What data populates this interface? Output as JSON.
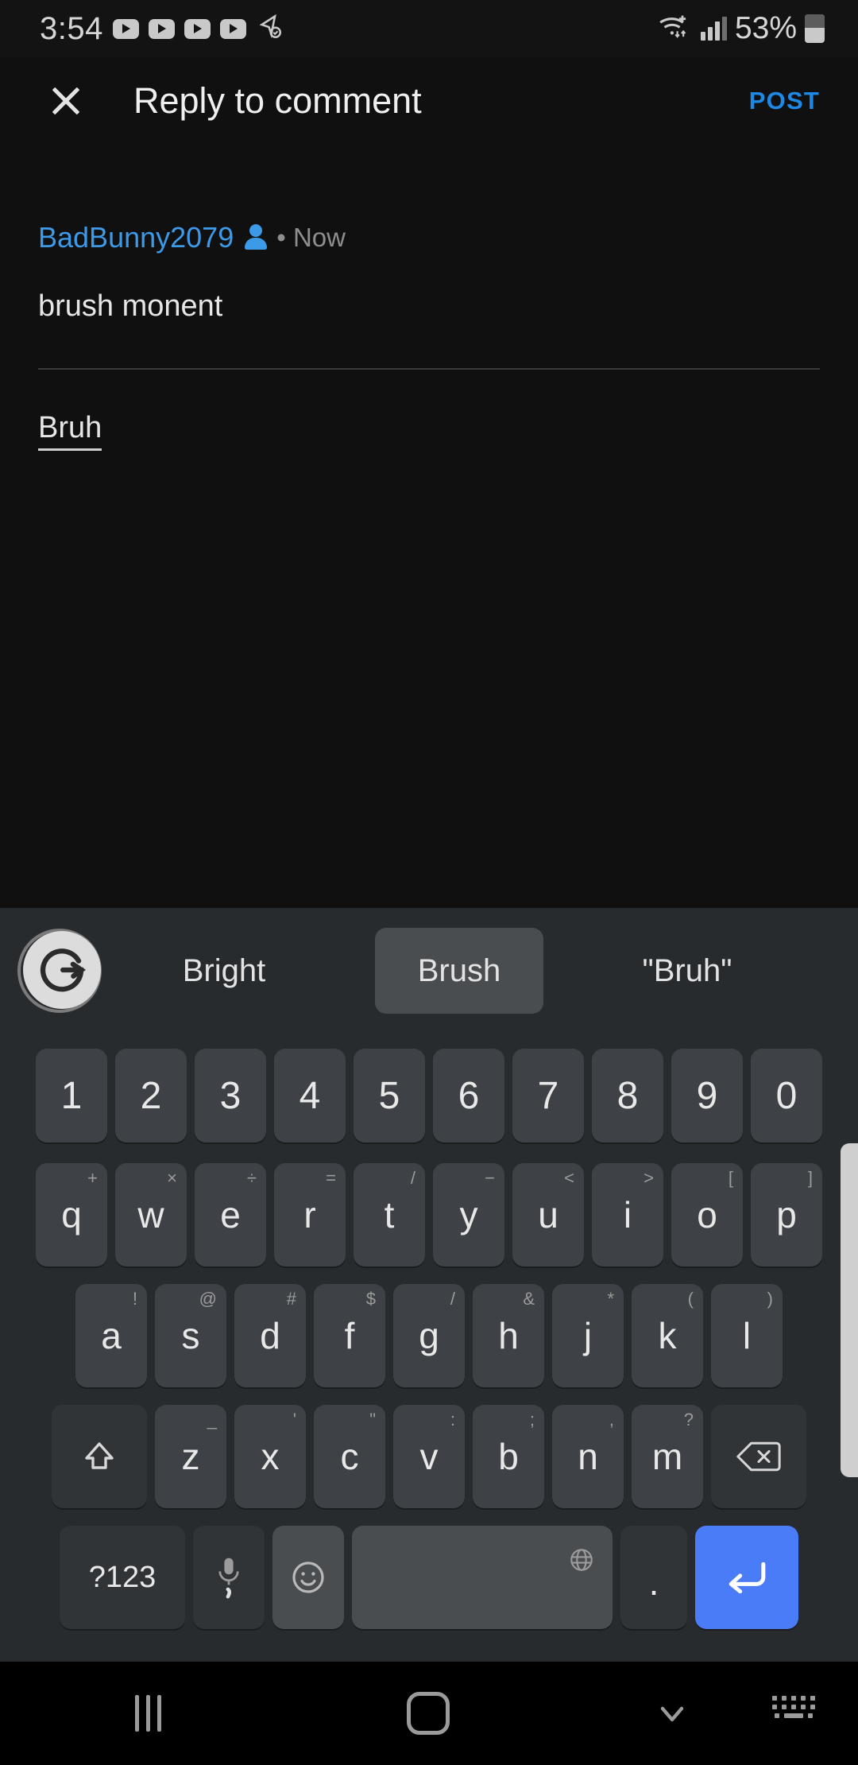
{
  "status_bar": {
    "time": "3:54",
    "notification_icons": [
      "youtube-icon",
      "youtube-icon",
      "youtube-icon",
      "youtube-icon",
      "location-check-icon"
    ],
    "wifi_icon": "wifi-plus-icon",
    "signal_icon": "cellular-signal-icon",
    "battery_percent": "53%",
    "battery_icon": "battery-icon"
  },
  "header": {
    "close_icon": "close-icon",
    "title": "Reply to comment",
    "post_label": "POST",
    "post_color": "#1e88e5"
  },
  "comment": {
    "username": "BadBunny2079",
    "username_color": "#3d9ae8",
    "verified_icon": "person-icon",
    "separator": "•",
    "timestamp": "Now",
    "text": "brush monent"
  },
  "reply_input": {
    "value": "Bruh",
    "composing": true
  },
  "keyboard": {
    "assistant_icon": "grammarly-g-icon",
    "suggestions": [
      {
        "label": "Bright",
        "selected": false
      },
      {
        "label": "Brush",
        "selected": true
      },
      {
        "label": "\"Bruh\"",
        "selected": false
      }
    ],
    "rows": {
      "numbers": [
        {
          "main": "1"
        },
        {
          "main": "2"
        },
        {
          "main": "3"
        },
        {
          "main": "4"
        },
        {
          "main": "5"
        },
        {
          "main": "6"
        },
        {
          "main": "7"
        },
        {
          "main": "8"
        },
        {
          "main": "9"
        },
        {
          "main": "0"
        }
      ],
      "top": [
        {
          "main": "q",
          "sup": "+"
        },
        {
          "main": "w",
          "sup": "×"
        },
        {
          "main": "e",
          "sup": "÷"
        },
        {
          "main": "r",
          "sup": "="
        },
        {
          "main": "t",
          "sup": "/"
        },
        {
          "main": "y",
          "sup": "−"
        },
        {
          "main": "u",
          "sup": "<"
        },
        {
          "main": "i",
          "sup": ">"
        },
        {
          "main": "o",
          "sup": "["
        },
        {
          "main": "p",
          "sup": "]"
        }
      ],
      "home": [
        {
          "main": "a",
          "sup": "!"
        },
        {
          "main": "s",
          "sup": "@"
        },
        {
          "main": "d",
          "sup": "#"
        },
        {
          "main": "f",
          "sup": "$"
        },
        {
          "main": "g",
          "sup": "/"
        },
        {
          "main": "h",
          "sup": "&"
        },
        {
          "main": "j",
          "sup": "*"
        },
        {
          "main": "k",
          "sup": "("
        },
        {
          "main": "l",
          "sup": ")"
        }
      ],
      "bottom": [
        {
          "main": "z",
          "sup": "_"
        },
        {
          "main": "x",
          "sup": "'"
        },
        {
          "main": "c",
          "sup": "\""
        },
        {
          "main": "v",
          "sup": ":"
        },
        {
          "main": "b",
          "sup": ";"
        },
        {
          "main": "n",
          "sup": ","
        },
        {
          "main": "m",
          "sup": "?"
        }
      ]
    },
    "shift_icon": "shift-icon",
    "backspace_icon": "backspace-icon",
    "symbols_label": "?123",
    "mic_icon": "microphone-icon",
    "mic_sub": ",",
    "emoji_icon": "emoji-icon",
    "space_icon": "globe-icon",
    "period_label": "·",
    "enter_icon": "enter-icon",
    "enter_color": "#4a7cf7"
  },
  "nav_bar": {
    "recents_icon": "recents-icon",
    "home_icon": "home-icon",
    "back_icon": "chevron-down-icon",
    "keyboard_switch_icon": "keyboard-switch-icon"
  }
}
